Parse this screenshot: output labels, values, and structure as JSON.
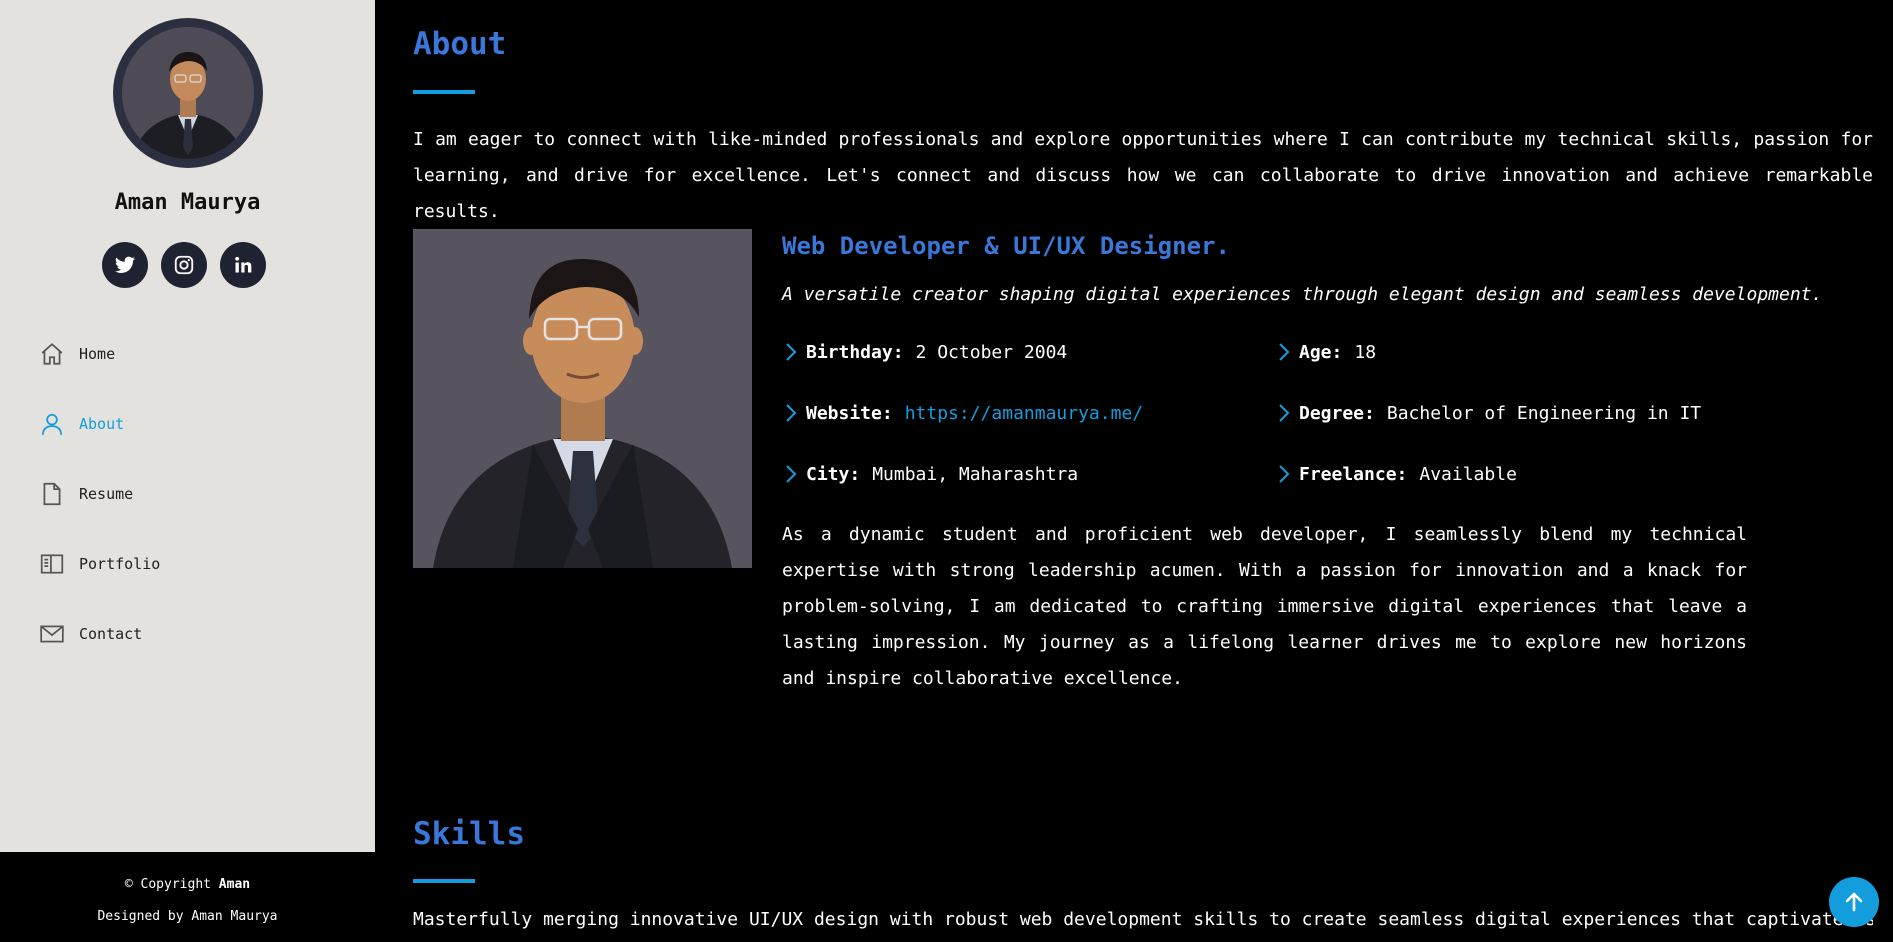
{
  "profile": {
    "name": "Aman Maurya",
    "socials": [
      {
        "name": "twitter-icon"
      },
      {
        "name": "instagram-icon"
      },
      {
        "name": "linkedin-icon"
      }
    ]
  },
  "nav": {
    "items": [
      {
        "label": "Home",
        "icon": "home-icon"
      },
      {
        "label": "About",
        "icon": "user-icon",
        "active": true
      },
      {
        "label": "Resume",
        "icon": "file-icon"
      },
      {
        "label": "Portfolio",
        "icon": "portfolio-icon"
      },
      {
        "label": "Contact",
        "icon": "envelope-icon"
      }
    ]
  },
  "footer": {
    "copyright_prefix": "© Copyright ",
    "copyright_name": "Aman",
    "designed_by": "Designed by Aman Maurya"
  },
  "about": {
    "title": "About",
    "intro": "I am eager to connect with like-minded professionals and explore opportunities where I can contribute my technical skills, passion for learning, and drive for excellence. Let's connect and discuss how we can collaborate to drive innovation and achieve remarkable results.",
    "role": "Web Developer & UI/UX Designer.",
    "tagline": "A versatile creator shaping digital experiences through elegant design and seamless development.",
    "info": {
      "birthday_label": "Birthday:",
      "birthday": "2 October 2004",
      "age_label": "Age:",
      "age": "18",
      "website_label": "Website:",
      "website": "https://amanmaurya.me/",
      "degree_label": "Degree:",
      "degree": "Bachelor of Engineering in IT",
      "city_label": "City:",
      "city": "Mumbai, Maharashtra",
      "freelance_label": "Freelance:",
      "freelance": "Available"
    },
    "bio": "As a dynamic student and proficient web developer, I seamlessly blend my technical expertise with strong leadership acumen. With a passion for innovation and a knack for problem-solving, I am dedicated to crafting immersive digital experiences that leave a lasting impression. My journey as a lifelong learner drives me to explore new horizons and inspire collaborative excellence."
  },
  "skills": {
    "title": "Skills",
    "intro": "Masterfully merging innovative UI/UX design with robust web development skills to create seamless digital experiences that captivate users and drive"
  },
  "colors": {
    "accent": "#149ddd",
    "heading": "#3b76d9",
    "sidebar_bg": "#e4e2de",
    "main_bg": "#000000"
  }
}
